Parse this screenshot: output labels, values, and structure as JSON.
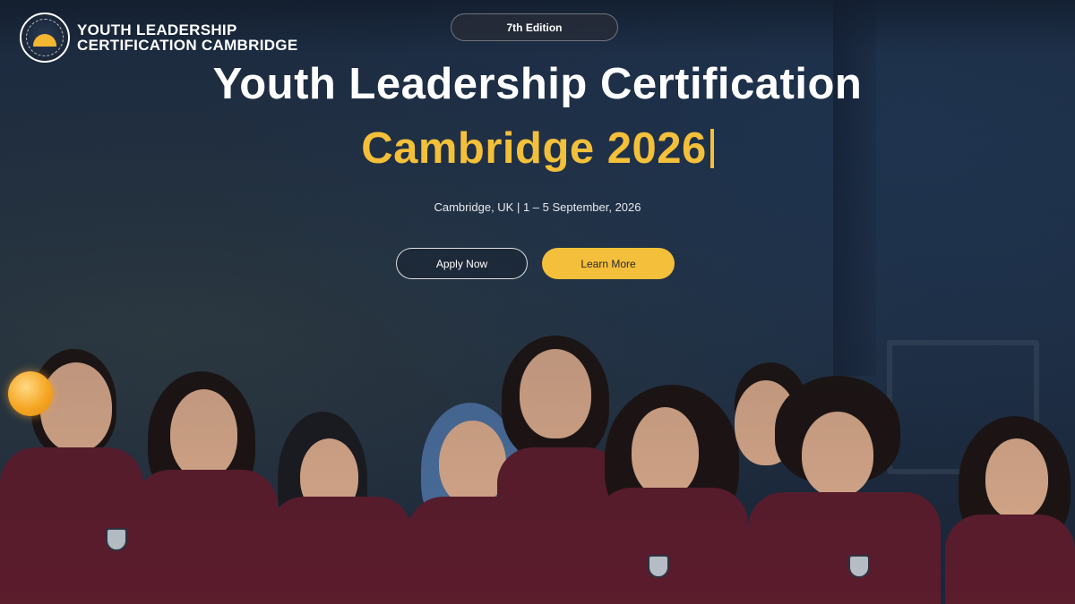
{
  "brand": {
    "line1": "YOUTH LEADERSHIP",
    "line2": "CERTIFICATION CAMBRIDGE"
  },
  "hero": {
    "edition": "7th Edition",
    "title": "Youth Leadership Certification",
    "subtitle": "Cambridge 2026",
    "meta": "Cambridge, UK | 1 – 5 September, 2026"
  },
  "cta": {
    "apply_label": "Apply Now",
    "learn_label": "Learn More"
  },
  "colors": {
    "accent": "#f4bf3a",
    "shirt": "#5b1c2c"
  }
}
